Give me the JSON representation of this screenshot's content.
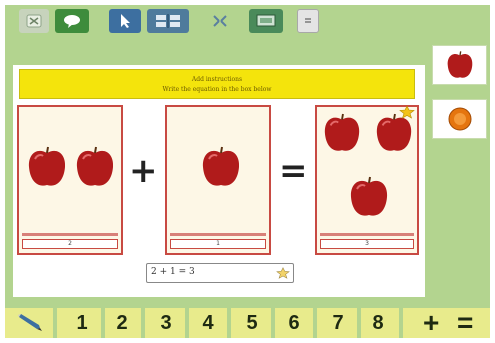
{
  "toolbar": {
    "buttons": [
      {
        "name": "close-icon",
        "color": "#c7d3bc"
      },
      {
        "name": "speech-bubble-icon",
        "color": "#3e8c3c"
      },
      {
        "name": "pointer-icon",
        "color": "#3d6fa0"
      },
      {
        "name": "grid-icon",
        "color": "#4f7b9c"
      },
      {
        "name": "compress-icon",
        "color": "#b3d48f"
      },
      {
        "name": "monitor-icon",
        "color": "#4a8a5a"
      },
      {
        "name": "dropdown-icon",
        "color": "#e4e4e4"
      }
    ]
  },
  "instruction": {
    "line1": "Add instructions",
    "line2": "Write the equation in the box below"
  },
  "equation": {
    "left": {
      "apples": 2,
      "count": "2"
    },
    "operator": "+",
    "right": {
      "apples": 1,
      "count": "1"
    },
    "equals": "=",
    "result": {
      "apples": 3,
      "count": "3"
    },
    "answer_text": "2 + 1 = 3"
  },
  "palette": {
    "items": [
      {
        "name": "apple-tile-icon"
      },
      {
        "name": "orange-tile-icon"
      }
    ]
  },
  "number_bar": {
    "numbers": [
      "1",
      "2",
      "3",
      "4",
      "5",
      "6",
      "7",
      "8"
    ],
    "plus": "+",
    "equals": "="
  },
  "colors": {
    "background_green": "#b3d48f",
    "banner_yellow": "#f4e40c",
    "card_border": "#c84a42",
    "apple_red": "#b01b1b",
    "number_bar": "#e8eb8c"
  }
}
